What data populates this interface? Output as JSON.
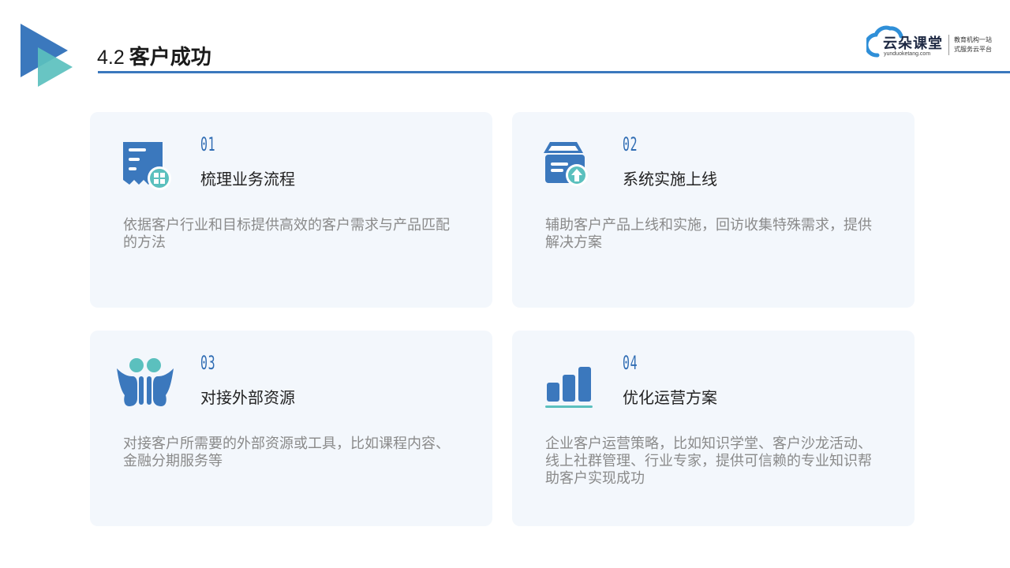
{
  "header": {
    "title_number": "4.2",
    "title_text": "客户成功"
  },
  "brand": {
    "name": "云朵课堂",
    "url": "yunduoketang.com",
    "slogan_line1": "教育机构一站",
    "slogan_line2": "式服务云平台"
  },
  "colors": {
    "accent_blue": "#3b78bd",
    "teal": "#5bc0be",
    "card_background": "#f3f7fc"
  },
  "cards": [
    {
      "number": "01",
      "icon": "document-icon",
      "title": "梳理业务流程",
      "description": "依据客户行业和目标提供高效的客户需求与产品匹配的方法"
    },
    {
      "number": "02",
      "icon": "upload-box-icon",
      "title": "系统实施上线",
      "description": "辅助客户产品上线和实施，回访收集特殊需求，提供解决方案"
    },
    {
      "number": "03",
      "icon": "partners-icon",
      "title": "对接外部资源",
      "description": "对接客户所需要的外部资源或工具，比如课程内容、金融分期服务等"
    },
    {
      "number": "04",
      "icon": "bar-chart-icon",
      "title": "优化运营方案",
      "description": "企业客户运营策略，比如知识学堂、客户沙龙活动、线上社群管理、行业专家，提供可信赖的专业知识帮助客户实现成功"
    }
  ]
}
